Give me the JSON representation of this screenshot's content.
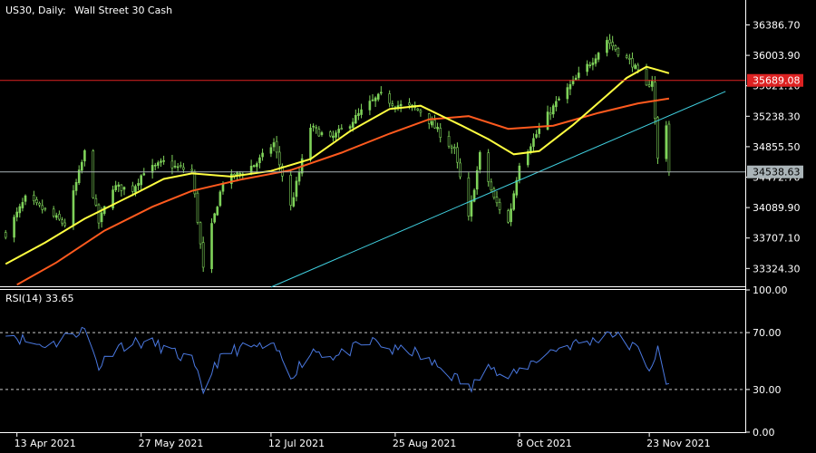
{
  "header": {
    "symbol": "US30, Daily:",
    "description": "Wall Street 30 Cash"
  },
  "rsi_label": "RSI(14) 33.65",
  "colors": {
    "background": "#000000",
    "bull": "#7fd35a",
    "bear": "#ffffff",
    "ma_fast": "#ffff40",
    "ma_slow": "#ff5a1e",
    "resistance": "#dd2222",
    "trendline": "#40d0e0",
    "rsi": "#4a78e0",
    "current": "#aab4b8"
  },
  "chart_data": [
    {
      "type": "candlestick",
      "title": "",
      "x_tick_labels": [
        "13 Apr 2021",
        "27 May 2021",
        "12 Jul 2021",
        "25 Aug 2021",
        "8 Oct 2021",
        "23 Nov 2021"
      ],
      "x_tick_dates": [
        "2021-04-13",
        "2021-05-27",
        "2021-07-12",
        "2021-08-25",
        "2021-10-08",
        "2021-11-23"
      ],
      "y_ticks": [
        36386.7,
        36003.9,
        35621.1,
        35238.3,
        34855.5,
        34472.7,
        34089.9,
        33707.1,
        33324.3
      ],
      "ylim": [
        33100,
        36700
      ],
      "resistance_level": 35689.08,
      "resistance_label": "35689.08",
      "current_price": 34538.63,
      "current_label": "34538.63",
      "trendline": [
        [
          "2021-07-12",
          33090
        ],
        [
          "2021-12-20",
          35550
        ]
      ],
      "close_path": [
        [
          "2021-04-09",
          33760
        ],
        [
          "2021-04-16",
          34200
        ],
        [
          "2021-04-23",
          34050
        ],
        [
          "2021-04-30",
          33880
        ],
        [
          "2021-05-07",
          34780
        ],
        [
          "2021-05-12",
          33900
        ],
        [
          "2021-05-17",
          34350
        ],
        [
          "2021-05-24",
          34320
        ],
        [
          "2021-05-28",
          34550
        ],
        [
          "2021-06-01",
          34600
        ],
        [
          "2021-06-04",
          34660
        ],
        [
          "2021-06-08",
          34600
        ],
        [
          "2021-06-14",
          34550
        ],
        [
          "2021-06-18",
          33310
        ],
        [
          "2021-06-21",
          33850
        ],
        [
          "2021-06-25",
          34420
        ],
        [
          "2021-06-30",
          34500
        ],
        [
          "2021-07-07",
          34650
        ],
        [
          "2021-07-13",
          34900
        ],
        [
          "2021-07-19",
          34100
        ],
        [
          "2021-07-26",
          35100
        ],
        [
          "2021-08-02",
          34950
        ],
        [
          "2021-08-09",
          35150
        ],
        [
          "2021-08-16",
          35400
        ],
        [
          "2021-08-20",
          35500
        ],
        [
          "2021-08-25",
          35380
        ],
        [
          "2021-08-31",
          35350
        ],
        [
          "2021-09-03",
          35300
        ],
        [
          "2021-09-08",
          35100
        ],
        [
          "2021-09-15",
          34800
        ],
        [
          "2021-09-20",
          33950
        ],
        [
          "2021-09-24",
          34750
        ],
        [
          "2021-09-29",
          34200
        ],
        [
          "2021-10-04",
          33900
        ],
        [
          "2021-10-08",
          34650
        ],
        [
          "2021-10-13",
          34950
        ],
        [
          "2021-10-18",
          35250
        ],
        [
          "2021-10-22",
          35450
        ],
        [
          "2021-10-29",
          35750
        ],
        [
          "2021-11-03",
          35950
        ],
        [
          "2021-11-08",
          36200
        ],
        [
          "2021-11-12",
          36050
        ],
        [
          "2021-11-17",
          35900
        ],
        [
          "2021-11-22",
          35600
        ],
        [
          "2021-11-24",
          35700
        ],
        [
          "2021-11-26",
          34700
        ],
        [
          "2021-11-29",
          35150
        ],
        [
          "2021-11-30",
          34540
        ]
      ],
      "ma_fast": [
        [
          "2021-04-09",
          33380
        ],
        [
          "2021-04-23",
          33650
        ],
        [
          "2021-05-07",
          33950
        ],
        [
          "2021-05-24",
          34250
        ],
        [
          "2021-06-04",
          34450
        ],
        [
          "2021-06-14",
          34520
        ],
        [
          "2021-06-28",
          34480
        ],
        [
          "2021-07-12",
          34550
        ],
        [
          "2021-07-26",
          34700
        ],
        [
          "2021-08-09",
          35050
        ],
        [
          "2021-08-23",
          35330
        ],
        [
          "2021-09-03",
          35370
        ],
        [
          "2021-09-17",
          35130
        ],
        [
          "2021-09-27",
          34950
        ],
        [
          "2021-10-06",
          34760
        ],
        [
          "2021-10-15",
          34800
        ],
        [
          "2021-10-27",
          35130
        ],
        [
          "2021-11-08",
          35500
        ],
        [
          "2021-11-15",
          35720
        ],
        [
          "2021-11-22",
          35860
        ],
        [
          "2021-11-26",
          35820
        ],
        [
          "2021-11-30",
          35780
        ]
      ],
      "ma_slow": [
        [
          "2021-04-13",
          33120
        ],
        [
          "2021-04-27",
          33400
        ],
        [
          "2021-05-14",
          33800
        ],
        [
          "2021-05-31",
          34100
        ],
        [
          "2021-06-14",
          34300
        ],
        [
          "2021-07-01",
          34440
        ],
        [
          "2021-07-19",
          34560
        ],
        [
          "2021-08-06",
          34780
        ],
        [
          "2021-08-23",
          35020
        ],
        [
          "2021-09-06",
          35200
        ],
        [
          "2021-09-20",
          35240
        ],
        [
          "2021-10-04",
          35080
        ],
        [
          "2021-10-20",
          35120
        ],
        [
          "2021-11-05",
          35280
        ],
        [
          "2021-11-19",
          35400
        ],
        [
          "2021-11-30",
          35460
        ]
      ]
    },
    {
      "type": "line",
      "title": "",
      "y_ticks": [
        100,
        70,
        30,
        0
      ],
      "y_tick_labels": [
        "100.00",
        "70.00",
        "30.00",
        "0.00"
      ],
      "levels": [
        70,
        30
      ],
      "ylim": [
        0,
        100
      ],
      "series": [
        {
          "values": [
            [
              "2021-04-09",
              72
            ],
            [
              "2021-04-14",
              66
            ],
            [
              "2021-04-19",
              62
            ],
            [
              "2021-04-26",
              62
            ],
            [
              "2021-05-03",
              70
            ],
            [
              "2021-05-07",
              72
            ],
            [
              "2021-05-12",
              46
            ],
            [
              "2021-05-18",
              60
            ],
            [
              "2021-05-25",
              63
            ],
            [
              "2021-06-01",
              62
            ],
            [
              "2021-06-08",
              55
            ],
            [
              "2021-06-14",
              50
            ],
            [
              "2021-06-18",
              28
            ],
            [
              "2021-06-22",
              48
            ],
            [
              "2021-06-29",
              58
            ],
            [
              "2021-07-07",
              60
            ],
            [
              "2021-07-14",
              58
            ],
            [
              "2021-07-19",
              40
            ],
            [
              "2021-07-27",
              58
            ],
            [
              "2021-08-04",
              53
            ],
            [
              "2021-08-12",
              60
            ],
            [
              "2021-08-18",
              64
            ],
            [
              "2021-08-24",
              57
            ],
            [
              "2021-08-30",
              58
            ],
            [
              "2021-09-03",
              53
            ],
            [
              "2021-09-10",
              45
            ],
            [
              "2021-09-17",
              36
            ],
            [
              "2021-09-21",
              30
            ],
            [
              "2021-09-27",
              52
            ],
            [
              "2021-10-01",
              38
            ],
            [
              "2021-10-06",
              40
            ],
            [
              "2021-10-13",
              50
            ],
            [
              "2021-10-20",
              58
            ],
            [
              "2021-10-27",
              62
            ],
            [
              "2021-11-03",
              64
            ],
            [
              "2021-11-09",
              71
            ],
            [
              "2021-11-15",
              62
            ],
            [
              "2021-11-19",
              58
            ],
            [
              "2021-11-23",
              45
            ],
            [
              "2021-11-26",
              57
            ],
            [
              "2021-11-29",
              32
            ],
            [
              "2021-11-30",
              33.65
            ]
          ]
        }
      ]
    }
  ]
}
